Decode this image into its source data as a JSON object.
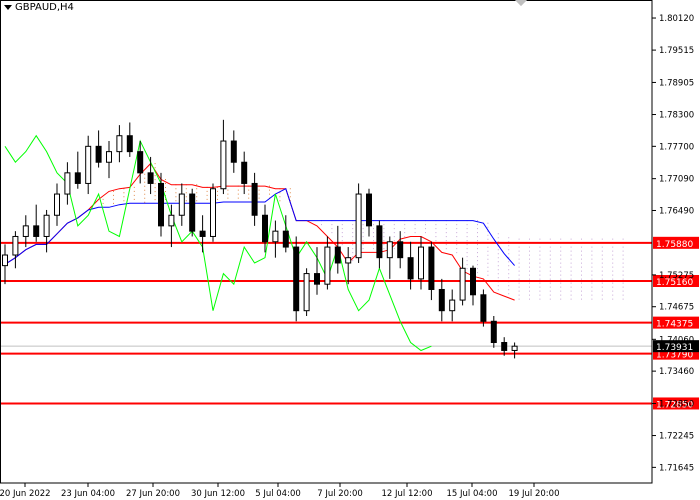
{
  "chart": {
    "symbol": "GBPAUD,H4",
    "colors": {
      "background": "#ffffff",
      "bull_candle": "#000000",
      "bear_candle": "#000000",
      "tenkan": "#ff0000",
      "kijun": "#0000ff",
      "chikou": "#00ff00",
      "kumo_up": "#e08a4a",
      "kumo_down": "#c8a8d8",
      "level_line": "#ff0000",
      "current_price_line": "#c0c0c0"
    }
  },
  "chart_data": {
    "type": "candlestick",
    "title": "GBPAUD,H4",
    "ylim": [
      1.7135,
      1.8046
    ],
    "y_ticks": [
      "1.80120",
      "1.79515",
      "1.78905",
      "1.78300",
      "1.77700",
      "1.77090",
      "1.76490",
      "1.75275",
      "1.74675",
      "1.74060",
      "1.73460",
      "1.72850",
      "1.72245",
      "1.71645"
    ],
    "x_ticks": [
      "20 Jun 2022",
      "23 Jun 04:00",
      "27 Jun 20:00",
      "30 Jun 12:00",
      "5 Jul 04:00",
      "7 Jul 20:00",
      "12 Jul 12:00",
      "15 Jul 04:00",
      "19 Jul 20:00"
    ],
    "levels": [
      {
        "label": "1.75880",
        "value": 1.7588
      },
      {
        "label": "1.75160",
        "value": 1.7516
      },
      {
        "label": "1.74375",
        "value": 1.74375
      },
      {
        "label": "1.73790",
        "value": 1.7379
      },
      {
        "label": "1.72850",
        "value": 1.7285
      }
    ],
    "current_price": {
      "label": "1.73931",
      "value": 1.73931
    },
    "candles": [
      [
        1.7545,
        1.7585,
        1.751,
        1.7565
      ],
      [
        1.7565,
        1.761,
        1.754,
        1.76
      ],
      [
        1.76,
        1.764,
        1.758,
        1.762
      ],
      [
        1.762,
        1.766,
        1.759,
        1.76
      ],
      [
        1.76,
        1.765,
        1.757,
        1.764
      ],
      [
        1.764,
        1.77,
        1.762,
        1.768
      ],
      [
        1.768,
        1.774,
        1.766,
        1.772
      ],
      [
        1.772,
        1.776,
        1.769,
        1.77
      ],
      [
        1.77,
        1.779,
        1.768,
        1.777
      ],
      [
        1.777,
        1.78,
        1.773,
        1.774
      ],
      [
        1.774,
        1.778,
        1.771,
        1.776
      ],
      [
        1.776,
        1.781,
        1.774,
        1.779
      ],
      [
        1.779,
        1.7815,
        1.775,
        1.776
      ],
      [
        1.776,
        1.778,
        1.77,
        1.772
      ],
      [
        1.772,
        1.775,
        1.768,
        1.77
      ],
      [
        1.77,
        1.772,
        1.76,
        1.762
      ],
      [
        1.762,
        1.766,
        1.758,
        1.764
      ],
      [
        1.764,
        1.77,
        1.762,
        1.768
      ],
      [
        1.768,
        1.769,
        1.76,
        1.761
      ],
      [
        1.761,
        1.764,
        1.757,
        1.76
      ],
      [
        1.76,
        1.77,
        1.759,
        1.769
      ],
      [
        1.769,
        1.782,
        1.768,
        1.778
      ],
      [
        1.778,
        1.78,
        1.772,
        1.774
      ],
      [
        1.774,
        1.776,
        1.768,
        1.77
      ],
      [
        1.77,
        1.772,
        1.762,
        1.764
      ],
      [
        1.764,
        1.766,
        1.757,
        1.759
      ],
      [
        1.759,
        1.763,
        1.756,
        1.761
      ],
      [
        1.761,
        1.764,
        1.757,
        1.758
      ],
      [
        1.758,
        1.76,
        1.744,
        1.746
      ],
      [
        1.746,
        1.754,
        1.745,
        1.753
      ],
      [
        1.753,
        1.758,
        1.749,
        1.751
      ],
      [
        1.751,
        1.76,
        1.75,
        1.758
      ],
      [
        1.758,
        1.762,
        1.753,
        1.755
      ],
      [
        1.755,
        1.758,
        1.751,
        1.756
      ],
      [
        1.756,
        1.77,
        1.755,
        1.768
      ],
      [
        1.768,
        1.769,
        1.76,
        1.762
      ],
      [
        1.762,
        1.763,
        1.754,
        1.756
      ],
      [
        1.756,
        1.76,
        1.752,
        1.759
      ],
      [
        1.759,
        1.761,
        1.754,
        1.756
      ],
      [
        1.756,
        1.759,
        1.75,
        1.752
      ],
      [
        1.752,
        1.76,
        1.75,
        1.758
      ],
      [
        1.758,
        1.759,
        1.748,
        1.75
      ],
      [
        1.75,
        1.752,
        1.744,
        1.746
      ],
      [
        1.746,
        1.75,
        1.744,
        1.748
      ],
      [
        1.748,
        1.756,
        1.747,
        1.754
      ],
      [
        1.754,
        1.7545,
        1.747,
        1.749
      ],
      [
        1.749,
        1.75,
        1.743,
        1.744
      ],
      [
        1.744,
        1.745,
        1.739,
        1.74
      ],
      [
        1.74,
        1.741,
        1.7375,
        1.7385
      ],
      [
        1.7385,
        1.74,
        1.737,
        1.7393
      ]
    ]
  }
}
